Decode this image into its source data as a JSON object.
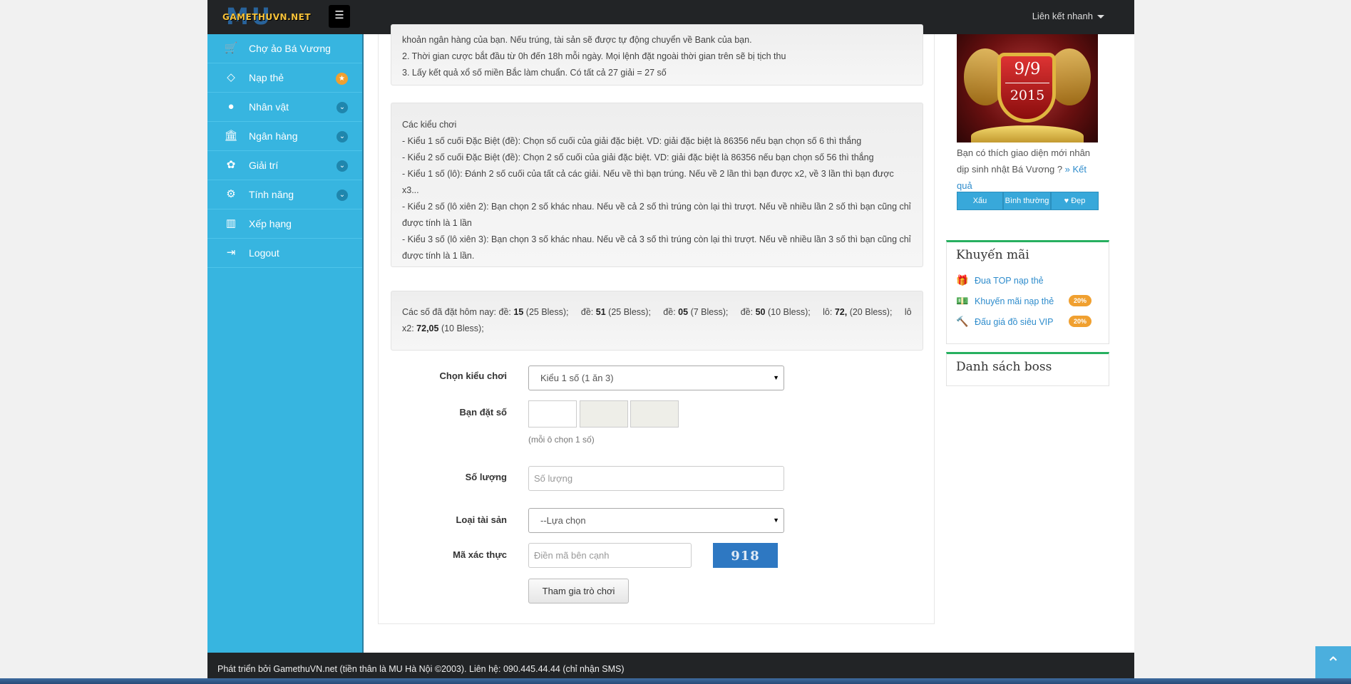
{
  "header": {
    "logo_top": "MU",
    "logo_text": "GAMETHUVN.NET",
    "menu_icon": "☰",
    "quick_links": "Liên kết nhanh"
  },
  "sidebar": {
    "items": [
      {
        "label": "Chợ ảo Bá Vương",
        "icon": "cart-icon",
        "glyph": "🛒"
      },
      {
        "label": "Nạp thẻ",
        "icon": "diamond-icon",
        "glyph": "◇",
        "badge": "★"
      },
      {
        "label": "Nhân vật",
        "icon": "user-icon",
        "glyph": "●",
        "chev": "⌄"
      },
      {
        "label": "Ngân hàng",
        "icon": "bank-icon",
        "glyph": "🏛",
        "chev": "⌄"
      },
      {
        "label": "Giải trí",
        "icon": "android-icon",
        "glyph": "✿",
        "chev": "⌄"
      },
      {
        "label": "Tính năng",
        "icon": "gears-icon",
        "glyph": "⚙",
        "chev": "⌄"
      },
      {
        "label": "Xếp hạng",
        "icon": "bar-chart-icon",
        "glyph": "▥"
      },
      {
        "label": "Logout",
        "icon": "logout-icon",
        "glyph": "⇥"
      }
    ]
  },
  "rules": {
    "line0": "khoản ngân hàng của bạn. Nếu trúng, tài sản sẽ được tự động chuyển về Bank của bạn.",
    "line1": "2. Thời gian cược bắt đầu từ 0h đến 18h mỗi ngày. Mọi lệnh đặt ngoài thời gian trên sẽ bị tịch thu",
    "line2": "3. Lấy kết quả xổ số miền Bắc làm chuẩn. Có tất cả 27 giải = 27 số"
  },
  "play_types": {
    "title": "Các kiểu chơi",
    "lines": [
      "- Kiểu 1 số cuối Đặc Biệt (đề): Chọn số cuối của giải đặc biệt. VD: giải đặc biệt là 86356 nếu bạn chọn số 6 thì thắng",
      "- Kiểu 2 số cuối Đặc Biệt (đề): Chọn 2 số cuối của giải đặc biệt. VD: giải đặc biệt là 86356 nếu bạn chọn số 56 thì thắng",
      "- Kiểu 1 số (lô): Đánh 2 số cuối của tất cả các giải. Nếu về thì bạn trúng. Nếu về 2 lần thì bạn được x2, về 3 lần thì bạn được x3...",
      "- Kiểu 2 số (lô xiên 2): Bạn chọn 2 số khác nhau. Nếu về cả 2 số thì trúng còn lại thì trượt. Nếu về nhiều lần 2 số thì bạn cũng chỉ được tính là 1 lần",
      "- Kiểu 3 số (lô xiên 3): Bạn chọn 3 số khác nhau. Nếu về cả 3 số thì trúng còn lại thì trượt. Nếu về nhiều lần 3 số thì bạn cũng chỉ được tính là 1 lần."
    ]
  },
  "bets_today": {
    "prefix": "Các số đã đặt hôm nay:",
    "entries": [
      {
        "kind": "đề:",
        "num": "15",
        "amt": "(25 Bless);"
      },
      {
        "kind": "đề:",
        "num": "51",
        "amt": "(25 Bless);"
      },
      {
        "kind": "đề:",
        "num": "05",
        "amt": "(7 Bless);"
      },
      {
        "kind": "đề:",
        "num": "50",
        "amt": "(10 Bless);"
      },
      {
        "kind": "lô:",
        "num": "72,",
        "amt": "(20 Bless);"
      },
      {
        "kind": "lô x2:",
        "num": "72,05",
        "amt": "(10 Bless);"
      }
    ]
  },
  "form": {
    "play_type_label": "Chọn kiểu chơi",
    "play_type_value": "Kiểu 1 số (1 ăn 3)",
    "number_label": "Bạn đặt số",
    "number_hint": "(mỗi ô chọn 1 số)",
    "quantity_label": "Số lượng",
    "quantity_placeholder": "Số lượng",
    "asset_label": "Loại tài sản",
    "asset_value": "--Lựa chọn",
    "captcha_label": "Mã xác thực",
    "captcha_placeholder": "Điền mã bên cạnh",
    "captcha_code": "918",
    "submit": "Tham gia trò chơi",
    "select_arrow": "▼"
  },
  "right": {
    "banner_day": "9/9",
    "banner_year": "2015",
    "poll_text": "Bạn có thích giao diện mới nhân dịp sinh nhật Bá Vương ?",
    "poll_link": "» Kết quả",
    "poll_buttons": [
      "Xấu",
      "Bình thường",
      "♥ Đẹp"
    ],
    "promo_title": "Khuyến mãi",
    "promos": [
      {
        "label": "Đua TOP nạp thẻ",
        "icon": "gift-icon",
        "glyph": "🎁",
        "badge": ""
      },
      {
        "label": "Khuyến mãi nạp thẻ",
        "icon": "money-icon",
        "glyph": "💵",
        "badge": "20%"
      },
      {
        "label": "Đấu giá đồ siêu VIP",
        "icon": "gavel-icon",
        "glyph": "🔨",
        "badge": "20%"
      }
    ],
    "boss_title": "Danh sách boss"
  },
  "footer": {
    "text": "Phát triển bởi GamethuVN.net (tiền thân là MU Hà Nội ©2003). Liên hệ: 090.445.44.44 (chỉ nhận SMS)"
  },
  "scroll_top_glyph": "⌃"
}
